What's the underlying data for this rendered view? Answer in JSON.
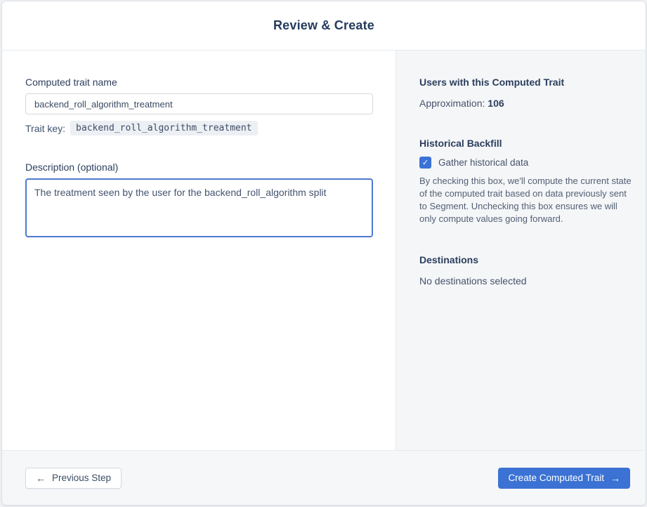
{
  "header": {
    "title": "Review & Create"
  },
  "form": {
    "name_label": "Computed trait name",
    "name_value": "backend_roll_algorithm_treatment",
    "trait_key_label": "Trait key:",
    "trait_key_value": "backend_roll_algorithm_treatment",
    "description_label": "Description (optional)",
    "description_value": "The treatment seen by the user for the backend_roll_algorithm split"
  },
  "sidebar": {
    "users_heading": "Users with this Computed Trait",
    "approximation_label": "Approximation:",
    "approximation_value": "106",
    "backfill_heading": "Historical Backfill",
    "checkbox_label": "Gather historical data",
    "checkbox_checked": true,
    "backfill_description": "By checking this box, we'll compute the current state of the computed trait based on data previously sent to Segment. Unchecking this box ensures we will only compute values going forward.",
    "destinations_heading": "Destinations",
    "destinations_empty": "No destinations selected"
  },
  "footer": {
    "previous_label": "Previous Step",
    "create_label": "Create Computed Trait"
  },
  "icons": {
    "checkmark": "✓",
    "arrow_left": "←",
    "arrow_right": "→"
  },
  "colors": {
    "primary_blue": "#3b72d4",
    "heading_navy": "#2c3e5d",
    "sidebar_bg": "#f4f6f8",
    "focus_border_blue": "#4d7ad0"
  }
}
